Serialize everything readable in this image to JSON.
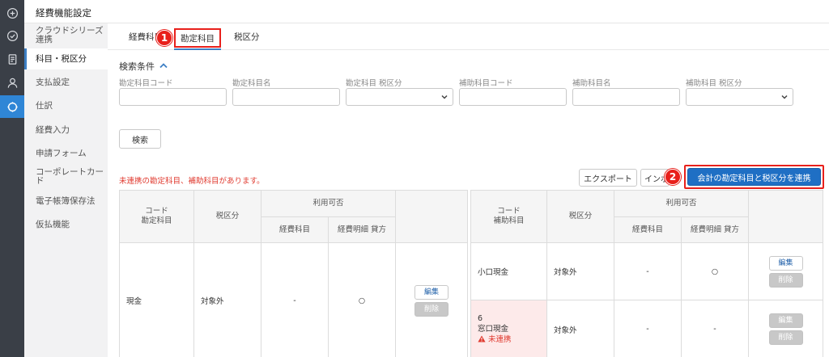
{
  "header": {
    "title": "経費機能設定"
  },
  "sidebar": {
    "items": [
      {
        "label": "クラウドシリーズ連携"
      },
      {
        "label": "科目・税区分"
      },
      {
        "label": "支払設定"
      },
      {
        "label": "仕訳"
      },
      {
        "label": "経費入力"
      },
      {
        "label": "申請フォーム"
      },
      {
        "label": "コーポレートカード"
      },
      {
        "label": "電子帳簿保存法"
      },
      {
        "label": "仮払機能"
      }
    ]
  },
  "tabs": [
    {
      "label": "経費科目"
    },
    {
      "label": "勘定科目"
    },
    {
      "label": "税区分"
    }
  ],
  "annotations": {
    "step1": "1",
    "step2": "2"
  },
  "search": {
    "heading": "検索条件",
    "fields": [
      {
        "label": "勘定科目コード"
      },
      {
        "label": "勘定科目名"
      },
      {
        "label": "勘定科目 税区分"
      },
      {
        "label": "補助科目コード"
      },
      {
        "label": "補助科目名"
      },
      {
        "label": "補助科目 税区分"
      }
    ],
    "button": "検索"
  },
  "warning": "未連携の勘定科目、補助科目があります。",
  "toolbar": {
    "export": "エクスポート",
    "import": "インポ",
    "link": "会計の勘定科目と税区分を連携"
  },
  "account_table": {
    "headers": {
      "code_line1": "コード",
      "code_line2": "勘定科目",
      "tax": "税区分",
      "usage": "利用可否",
      "expense_item": "経費科目",
      "expense_detail": "経費明細 貸方"
    },
    "rows": [
      {
        "name": "現金",
        "tax": "対象外",
        "expense_item": "-",
        "expense_detail": "○",
        "edit": "編集",
        "delete": "削除"
      }
    ]
  },
  "sub_table": {
    "headers": {
      "code_line1": "コード",
      "code_line2": "補助科目",
      "tax": "税区分",
      "usage": "利用可否",
      "expense_item": "経費科目",
      "expense_detail": "経費明細 貸方"
    },
    "rows": [
      {
        "code": "",
        "name": "小口現金",
        "status": "",
        "tax": "対象外",
        "expense_item": "-",
        "expense_detail": "○",
        "edit": "編集",
        "delete": "削除"
      },
      {
        "code": "6",
        "name": "窓口現金",
        "status": "未連携",
        "tax": "対象外",
        "expense_item": "-",
        "expense_detail": "-",
        "edit": "編集",
        "delete": "削除"
      }
    ]
  },
  "colors": {
    "accent": "#1f6fc4",
    "highlight": "#e8201b",
    "rail": "#3a3f47",
    "warning": "#e03a2f"
  }
}
